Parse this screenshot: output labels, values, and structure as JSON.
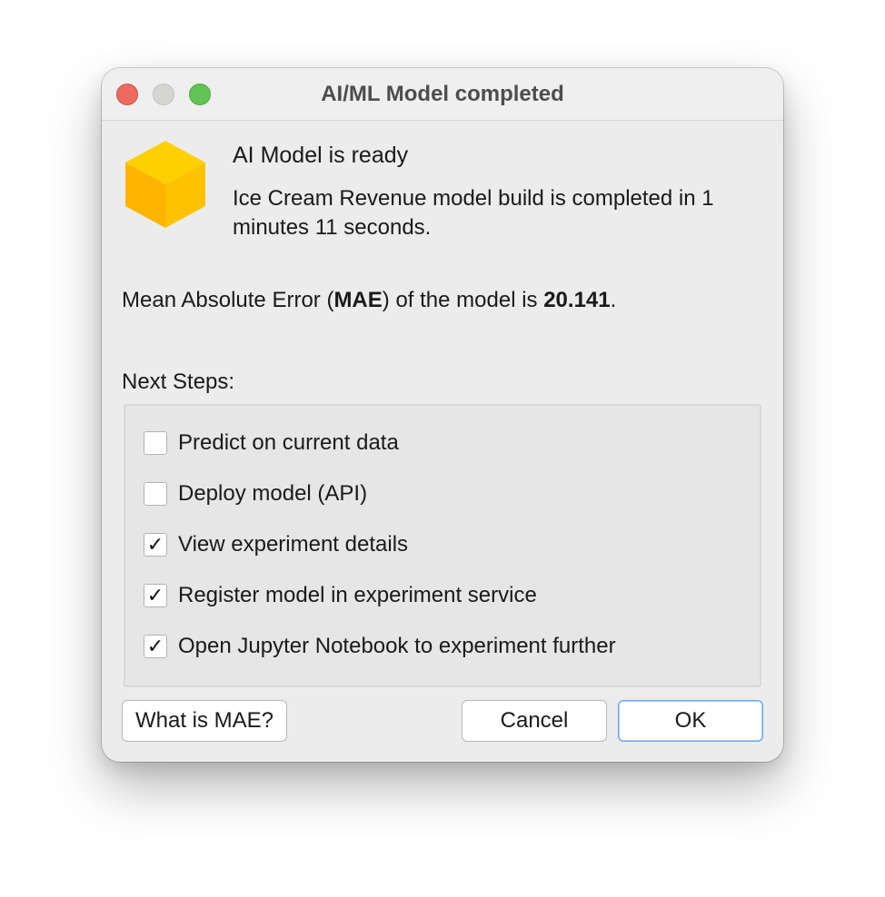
{
  "window": {
    "title": "AI/ML Model completed"
  },
  "icon": "model-cube-icon",
  "heading": "AI Model is ready",
  "description": "Ice Cream Revenue model build is completed in 1 minutes 11 seconds.",
  "mae": {
    "prefix": "Mean Absolute Error (",
    "metric": "MAE",
    "middle": ") of the model is ",
    "value": "20.141",
    "suffix": "."
  },
  "next_steps": {
    "label": "Next Steps:",
    "items": [
      {
        "label": "Predict on current data",
        "checked": false,
        "mark": ""
      },
      {
        "label": "Deploy model (API)",
        "checked": false,
        "mark": ""
      },
      {
        "label": "View experiment details",
        "checked": true,
        "mark": "✓"
      },
      {
        "label": "Register model in experiment service",
        "checked": true,
        "mark": "✓"
      },
      {
        "label": "Open Jupyter Notebook to experiment further",
        "checked": true,
        "mark": "✓"
      }
    ]
  },
  "buttons": {
    "help": "What is MAE?",
    "cancel": "Cancel",
    "ok": "OK"
  },
  "colors": {
    "cube_top": "#ffd000",
    "cube_left": "#ffb400",
    "cube_right": "#ffc200",
    "default_button_border": "#6aa6e8"
  }
}
